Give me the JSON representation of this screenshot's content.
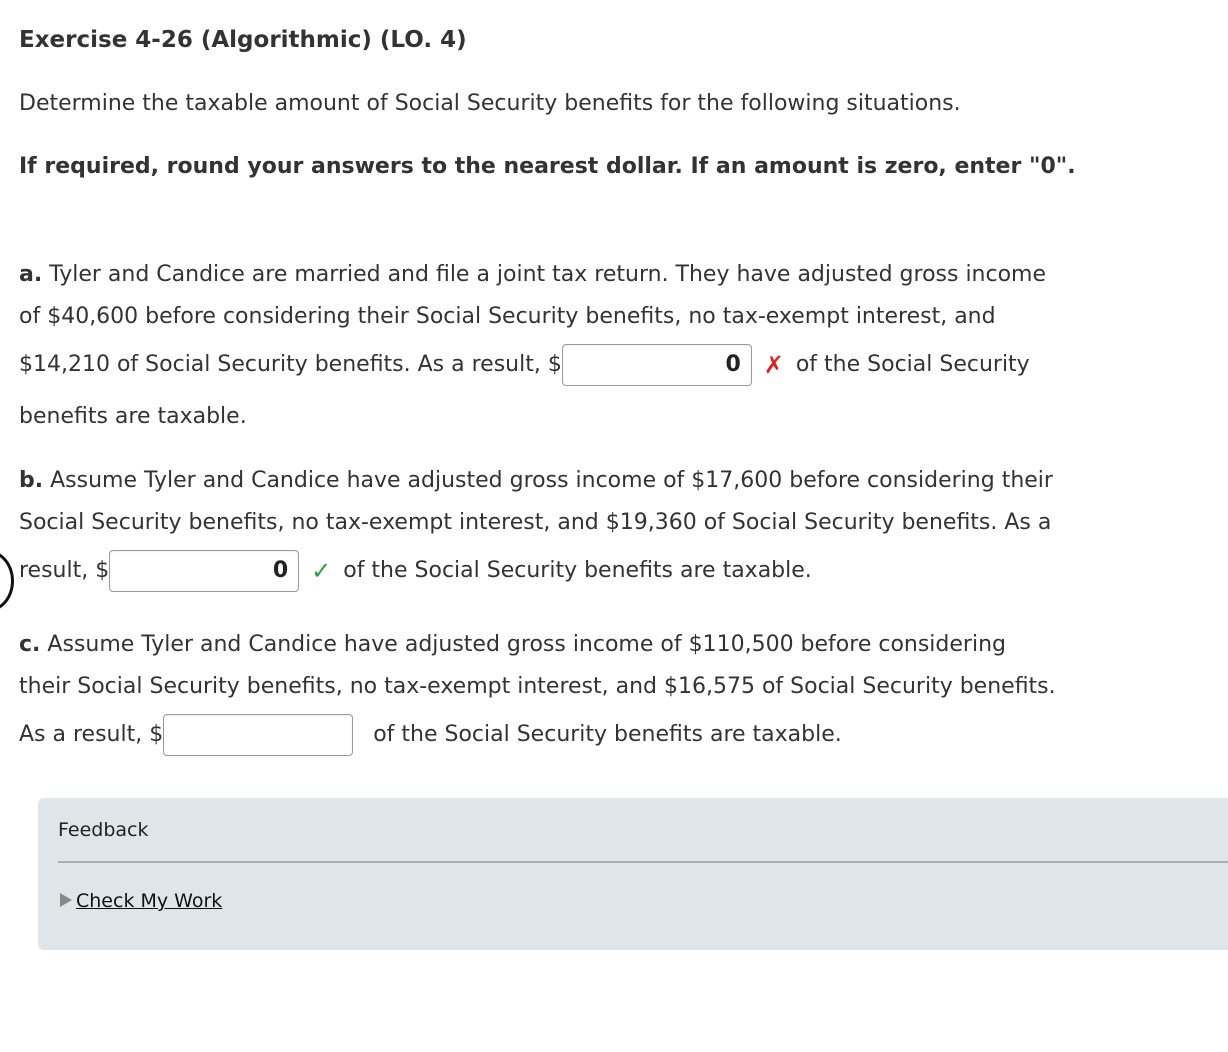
{
  "exercise": {
    "title": "Exercise 4-26 (Algorithmic) (LO. 4)",
    "intro": "Determine the taxable amount of Social Security benefits for the following situations.",
    "instructions": "If required, round your answers to the nearest dollar. If an amount is zero, enter \"0\"."
  },
  "parts": {
    "a": {
      "label": "a.",
      "line1": " Tyler and Candice are married and file a joint tax return. They have adjusted gross income",
      "line2": "of $40,600 before considering their Social Security benefits, no tax-exempt interest, and",
      "line3_before": "$14,210 of Social Security benefits. As a result, $",
      "answer": "0",
      "mark": "✗",
      "mark_status": "incorrect",
      "line3_after": "of the Social Security",
      "line4": "benefits are taxable."
    },
    "b": {
      "label": "b.",
      "line1": " Assume Tyler and Candice have adjusted gross income of $17,600 before considering their",
      "line2": "Social Security benefits, no tax-exempt interest, and $19,360 of Social Security benefits. As a",
      "line3_before": "result, $",
      "answer": "0",
      "mark": "✓",
      "mark_status": "correct",
      "line3_after": "of the Social Security benefits are taxable."
    },
    "c": {
      "label": "c.",
      "line1": " Assume Tyler and Candice have adjusted gross income of $110,500 before considering",
      "line2": "their Social Security benefits, no tax-exempt interest, and $16,575 of Social Security benefits.",
      "line3_before": "As a result, $",
      "answer": "",
      "line3_after": "of the Social Security benefits are taxable."
    }
  },
  "feedback": {
    "title": "Feedback",
    "check_my_work": "Check My Work"
  },
  "colors": {
    "incorrect": "#e02020",
    "correct": "#2f9e44",
    "feedback_bg": "#dfe6ea"
  },
  "icons": {
    "incorrect": "x-icon",
    "correct": "checkmark-icon",
    "expand": "triangle-right-icon"
  }
}
